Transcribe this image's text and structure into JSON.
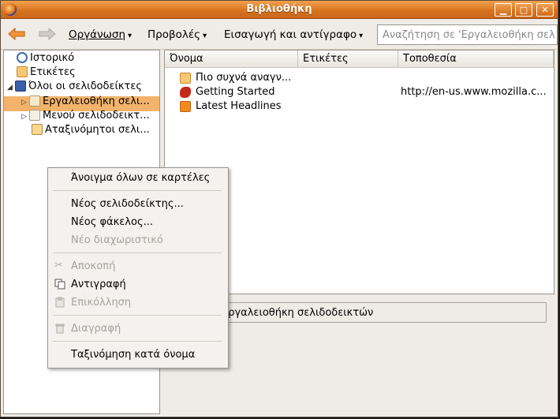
{
  "window": {
    "title": "Βιβλιοθήκη",
    "controls": [
      "minimize",
      "maximize",
      "close"
    ]
  },
  "toolbar": {
    "back_icon": "back-arrow-icon",
    "forward_icon": "forward-arrow-icon",
    "menus": [
      {
        "label": "Οργάνωση"
      },
      {
        "label": "Προβολές"
      },
      {
        "label": "Εισαγωγή και αντίγραφο"
      }
    ],
    "search_placeholder": "Αναζήτηση σε 'Εργαλειοθήκη σελ"
  },
  "tree": {
    "items": [
      {
        "label": "Ιστορικό",
        "icon": "clock-icon"
      },
      {
        "label": "Ετικέτες",
        "icon": "tag-folder-icon"
      },
      {
        "label": "Όλοι οι σελιδοδείκτες",
        "icon": "star-folder-icon",
        "expanded": true
      },
      {
        "label": "Εργαλειοθήκη σελι...",
        "icon": "toolbar-folder-icon",
        "selected": true
      },
      {
        "label": "Μενού σελιδοδεικτ...",
        "icon": "menu-folder-icon"
      },
      {
        "label": "Αταξινόμητοι σελι...",
        "icon": "unsorted-folder-icon"
      }
    ]
  },
  "list": {
    "columns": [
      "Όνομα",
      "Ετικέτες",
      "Τοποθεσία"
    ],
    "rows": [
      {
        "name": "Πιο συχνά αναγν...",
        "tags": "",
        "location": "",
        "icon": "smart-folder-icon"
      },
      {
        "name": "Getting Started",
        "tags": "",
        "location": "http://en-us.www.mozilla.c...",
        "icon": "mozilla-icon"
      },
      {
        "name": "Latest Headlines",
        "tags": "",
        "location": "",
        "icon": "rss-icon"
      }
    ]
  },
  "details": {
    "text": "Εργαλειοθήκη σελιδοδεικτών"
  },
  "context_menu": {
    "open_all": "Άνοιγμα όλων σε καρτέλες",
    "new_bookmark": "Νέος σελιδοδείκτης...",
    "new_folder": "Νέος φάκελος...",
    "new_separator": "Νέο διαχωριστικό",
    "cut": "Αποκοπή",
    "copy": "Αντιγραφή",
    "paste": "Επικόλληση",
    "delete": "Διαγραφή",
    "sort_by_name": "Ταξινόμηση κατά όνομα"
  },
  "colors": {
    "titlebar": "#d9741f",
    "selection": "#f3b36a",
    "disabled_text": "#a6a29d"
  }
}
